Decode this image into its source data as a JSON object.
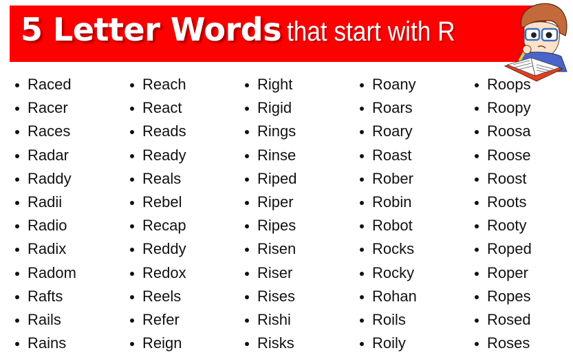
{
  "header": {
    "title_bold": "5 Letter Words",
    "title_light": "that start with R",
    "banner_color": "#fe0000",
    "mascot_icon": "thinking-reader-illustration"
  },
  "columns": [
    {
      "words": [
        "Raced",
        "Racer",
        "Races",
        "Radar",
        "Raddy",
        "Radii",
        "Radio",
        "Radix",
        "Radom",
        "Rafts",
        "Rails",
        "Rains"
      ]
    },
    {
      "words": [
        "Reach",
        "React",
        "Reads",
        "Ready",
        "Reals",
        "Rebel",
        "Recap",
        "Reddy",
        "Redox",
        "Reels",
        "Refer",
        "Reign"
      ]
    },
    {
      "words": [
        "Right",
        "Rigid",
        "Rings",
        "Rinse",
        "Riped",
        "Riper",
        "Ripes",
        "Risen",
        "Riser",
        "Rises",
        "Rishi",
        "Risks"
      ]
    },
    {
      "words": [
        "Roany",
        "Roars",
        "Roary",
        "Roast",
        "Rober",
        "Robin",
        "Robot",
        "Rocks",
        "Rocky",
        "Rohan",
        "Roils",
        "Roily"
      ]
    },
    {
      "words": [
        "Roops",
        "Roopy",
        "Roosa",
        "Roose",
        "Roost",
        "Roots",
        "Rooty",
        "Roped",
        "Roper",
        "Ropes",
        "Rosed",
        "Roses"
      ]
    }
  ]
}
